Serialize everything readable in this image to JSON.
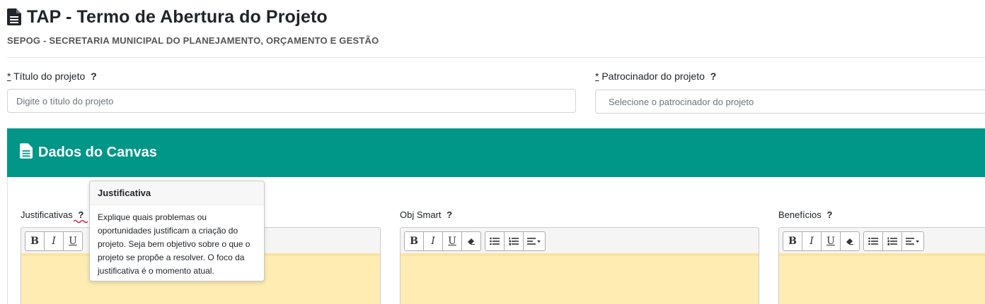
{
  "header": {
    "title": "TAP - Termo de Abertura do Projeto",
    "subtitle": "SEPOG - SECRETARIA MUNICIPAL DO PLANEJAMENTO, ORÇAMENTO E GESTÃO"
  },
  "form": {
    "titulo": {
      "required_mark": "*",
      "label": "Título do projeto",
      "help": "?",
      "placeholder": "Digite o título do projeto"
    },
    "patrocinador": {
      "required_mark": "*",
      "label": "Patrocinador do projeto",
      "help": "?",
      "placeholder": "Selecione o patrocinador do projeto"
    }
  },
  "canvas": {
    "title": "Dados do Canvas",
    "accent_color": "#009688",
    "editors": [
      {
        "label": "Justificativas",
        "help": "?"
      },
      {
        "label": "Obj Smart",
        "help": "?"
      },
      {
        "label": "Benefícios",
        "help": "?"
      }
    ],
    "toolbar": {
      "bold": "B",
      "italic": "I",
      "underline": "U"
    }
  },
  "popover": {
    "title": "Justificativa",
    "body": "Explique quais problemas ou oportunidades justificam a criação do projeto. Seja bem objetivo sobre o que o projeto se propõe a resolver. O foco da justificativa é o momento atual."
  }
}
